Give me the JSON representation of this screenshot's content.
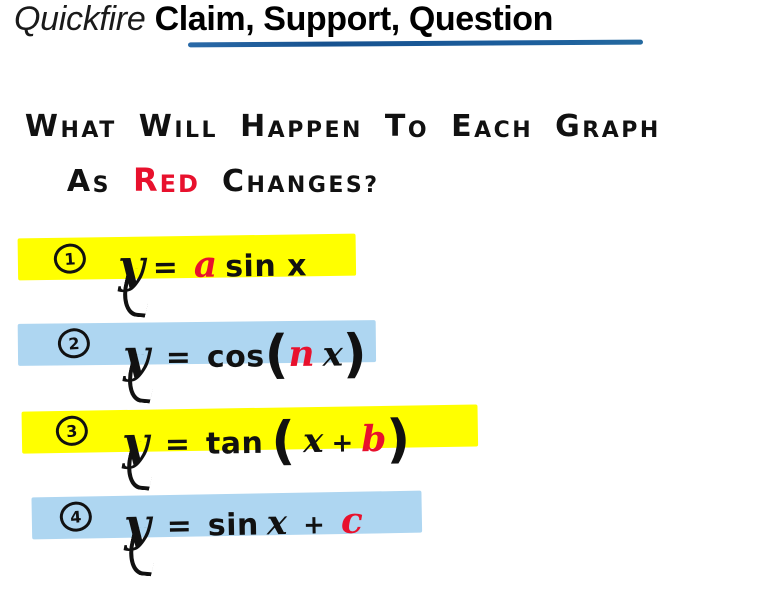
{
  "slide": {
    "background_color": "#ffffff",
    "title": {
      "light_part": "Quickfire",
      "bold_part": "Claim, Support, Question",
      "underline_color": "#1b5c9b"
    },
    "question": {
      "line1_before": "WHAT WILL HAPPEN TO EACH GRAPH",
      "line2_prefix": "AS",
      "line2_keyword": "RED",
      "line2_suffix": "CHANGES?",
      "keyword_color": "#e8112d",
      "line1_words": [
        {
          "cap": "W",
          "rest": "HAT"
        },
        {
          "cap": "W",
          "rest": "ILL"
        },
        {
          "cap": "H",
          "rest": "APPEN"
        },
        {
          "cap": "T",
          "rest": "O"
        },
        {
          "cap": "E",
          "rest": "ACH"
        },
        {
          "cap": "G",
          "rest": "RAPH"
        }
      ],
      "line2_as": {
        "cap": "A",
        "rest": "S"
      },
      "line2_red": {
        "cap": "R",
        "rest": "ED"
      },
      "line2_changes": {
        "cap": "C",
        "rest": "HANGES?"
      }
    },
    "equations": [
      {
        "number": "1",
        "highlight_color": "#ffff00",
        "highlight_name": "yellow",
        "lhs": "y",
        "equals": "=",
        "red_var": "a",
        "rhs_before": "",
        "rhs_after": "sin x",
        "full_text": "y = a sin x",
        "parens": false,
        "layout": "a-before-function"
      },
      {
        "number": "2",
        "highlight_color": "#aed6f1",
        "highlight_name": "blue",
        "lhs": "y",
        "equals": "=",
        "red_var": "n",
        "function": "cos",
        "inside_after": "x",
        "full_text": "y = cos(n x)",
        "parens": true,
        "layout": "function-paren-redvar-x"
      },
      {
        "number": "3",
        "highlight_color": "#ffff00",
        "highlight_name": "yellow",
        "lhs": "y",
        "equals": "=",
        "red_var": "b",
        "function": "tan",
        "inside_before": "x",
        "operator": "+",
        "full_text": "y = tan (x + b)",
        "parens": true,
        "layout": "function-paren-x-plus-redvar"
      },
      {
        "number": "4",
        "highlight_color": "#aed6f1",
        "highlight_name": "blue",
        "lhs": "y",
        "equals": "=",
        "red_var": "c",
        "function": "sin",
        "inside_before": "x",
        "operator": "+",
        "full_text": "y = sin x + c",
        "parens": false,
        "layout": "function-x-plus-redvar"
      }
    ]
  }
}
